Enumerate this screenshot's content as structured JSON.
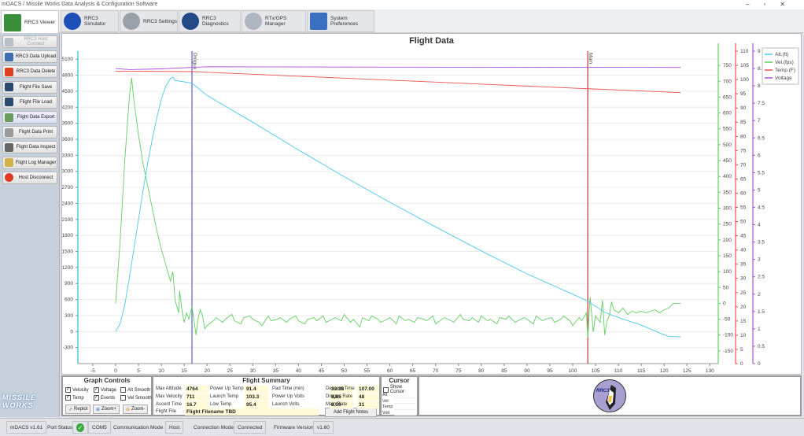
{
  "window": {
    "title": "mDACS / Missile Works Data Analysis & Configuration Software"
  },
  "tabs": [
    {
      "label": "RRC3 Viewer",
      "icon": "chart-icon",
      "color": "#3a8f3a"
    },
    {
      "label": "RRC3 Simulator",
      "icon": "rocket-icon",
      "color": "#1c4fb8"
    },
    {
      "label": "RRC3 Settings",
      "icon": "gear-icon",
      "color": "#9aa0a8"
    },
    {
      "label": "RRC3 Diagnostics",
      "icon": "waveform-icon",
      "color": "#234a86"
    },
    {
      "label": "RTx/GPS Manager",
      "icon": "compass-icon",
      "color": "#b0b6c0"
    },
    {
      "label": "System Preferences",
      "icon": "checklist-icon",
      "color": "#3b6fc0"
    }
  ],
  "sidebar": [
    {
      "label": "RRC3 Host Connect",
      "icon": "connect-icon",
      "color": "#b9bfc6",
      "disabled": true
    },
    {
      "label": "RRC3 Data Upload",
      "icon": "upload-icon",
      "color": "#3d6fb0"
    },
    {
      "label": "RRC3 Data Delete",
      "icon": "delete-x-icon",
      "color": "#e04020"
    },
    {
      "label": "Flight File Save",
      "icon": "save-icon",
      "color": "#2a4a70"
    },
    {
      "label": "Flight File Load",
      "icon": "load-icon",
      "color": "#2a4a70"
    },
    {
      "label": "Flight Data Export",
      "icon": "export-icon",
      "color": "#6c9c5a",
      "highlight": true
    },
    {
      "label": "Flight Data Print",
      "icon": "print-icon",
      "color": "#9a9a9a"
    },
    {
      "label": "Flight Data Inspect",
      "icon": "binoculars-icon",
      "color": "#666"
    },
    {
      "label": "Flight Log Manager",
      "icon": "log-icon",
      "color": "#d4b04a"
    },
    {
      "label": "Host Disconnect",
      "icon": "stop-icon",
      "color": "#e03a20"
    }
  ],
  "logo_text": "MISSILE WORKS",
  "chart_data": {
    "type": "line",
    "title": "Flight Data",
    "xlim": [
      -8,
      132
    ],
    "xticks": [
      -5,
      0,
      5,
      10,
      15,
      20,
      25,
      30,
      35,
      40,
      45,
      50,
      55,
      60,
      65,
      70,
      75,
      80,
      85,
      90,
      95,
      100,
      105,
      110,
      115,
      120,
      125,
      130
    ],
    "axes": {
      "altitude": {
        "ylim": [
          -600,
          5250
        ],
        "ticks": [
          -300,
          0,
          300,
          600,
          900,
          1200,
          1500,
          1800,
          2100,
          2400,
          2700,
          3000,
          3300,
          3600,
          3900,
          4200,
          4500,
          4800,
          5100
        ],
        "color": "#4fc8f0"
      },
      "velocity": {
        "ylim": [
          -190,
          795
        ],
        "ticks": [
          -150,
          -100,
          -50,
          0,
          50,
          100,
          150,
          200,
          250,
          300,
          350,
          400,
          450,
          500,
          550,
          600,
          650,
          700,
          750
        ],
        "color": "#62d062"
      },
      "temperature": {
        "ylim": [
          0,
          110
        ],
        "ticks": [
          0,
          5,
          10,
          15,
          20,
          25,
          30,
          35,
          40,
          45,
          50,
          55,
          60,
          65,
          70,
          75,
          80,
          85,
          90,
          95,
          100,
          105,
          110
        ],
        "color": "#f05050"
      },
      "voltage": {
        "ylim": [
          0,
          9
        ],
        "ticks": [
          0,
          0.5,
          1,
          1.5,
          2,
          2.5,
          3,
          3.5,
          4,
          4.5,
          5,
          5.5,
          6,
          6.5,
          7,
          7.5,
          8,
          8.5,
          9
        ],
        "color": "#b050e0"
      }
    },
    "legend": {
      "position": "top-right",
      "entries": [
        {
          "name": "Alt.(ft)",
          "color": "#4fc8f0"
        },
        {
          "name": "Vel.(fps)",
          "color": "#62d062"
        },
        {
          "name": "Temp.(F)",
          "color": "#f05050"
        },
        {
          "name": "Voltage",
          "color": "#b050e0"
        }
      ]
    },
    "events": [
      {
        "name": "Drogue",
        "t": 16.7,
        "color": "#6a6ad8"
      },
      {
        "name": "Main",
        "t": 103.3,
        "color": "#c84040"
      }
    ],
    "series": {
      "altitude": [
        [
          0,
          0
        ],
        [
          1,
          150
        ],
        [
          2,
          500
        ],
        [
          3,
          1000
        ],
        [
          4,
          1550
        ],
        [
          5,
          2100
        ],
        [
          6,
          2650
        ],
        [
          7,
          3150
        ],
        [
          8,
          3600
        ],
        [
          9,
          4000
        ],
        [
          10,
          4350
        ],
        [
          11,
          4600
        ],
        [
          12,
          4740
        ],
        [
          12.6,
          4764
        ],
        [
          13,
          4700
        ],
        [
          14,
          4690
        ],
        [
          16.7,
          4650
        ],
        [
          20,
          4420
        ],
        [
          30,
          3920
        ],
        [
          40,
          3400
        ],
        [
          50,
          2900
        ],
        [
          60,
          2420
        ],
        [
          70,
          1960
        ],
        [
          80,
          1510
        ],
        [
          90,
          1080
        ],
        [
          100,
          700
        ],
        [
          103.3,
          570
        ],
        [
          107,
          360
        ],
        [
          110,
          260
        ],
        [
          115,
          120
        ],
        [
          120,
          -60
        ],
        [
          121,
          -90
        ],
        [
          123.6,
          -100
        ]
      ],
      "velocity": [
        [
          0,
          0
        ],
        [
          1,
          200
        ],
        [
          2,
          450
        ],
        [
          3,
          650
        ],
        [
          3.5,
          711
        ],
        [
          4,
          640
        ],
        [
          5,
          530
        ],
        [
          6,
          440
        ],
        [
          7,
          370
        ],
        [
          8,
          300
        ],
        [
          9,
          230
        ],
        [
          10,
          170
        ],
        [
          11,
          120
        ],
        [
          12,
          70
        ],
        [
          12.5,
          100
        ],
        [
          12.8,
          50
        ],
        [
          13,
          10
        ],
        [
          13.8,
          -30
        ],
        [
          14,
          40
        ],
        [
          14.5,
          -20
        ],
        [
          15,
          -60
        ],
        [
          15.5,
          -30
        ],
        [
          16,
          -50
        ],
        [
          16.7,
          -10
        ],
        [
          17.3,
          -70
        ],
        [
          17.6,
          -100
        ],
        [
          18,
          -50
        ],
        [
          18.5,
          -20
        ],
        [
          19,
          -40
        ],
        [
          19.5,
          -80
        ]
      ],
      "velocity_noise": {
        "t_start": 20,
        "t_step": 1,
        "values": [
          -70,
          -55,
          -45,
          -60,
          -50,
          -35,
          -55,
          -65,
          -45,
          -40,
          -50,
          -60,
          -70,
          -40,
          -55,
          -50,
          -45,
          -60,
          -50,
          -40,
          -55,
          -65,
          -50,
          -45,
          -55,
          -40,
          -60,
          -50,
          -45,
          -55,
          -35,
          -60,
          -50,
          -75,
          -45,
          -55,
          -40,
          -50,
          -60,
          -50,
          -45,
          -65,
          -40,
          -55,
          -50,
          -60,
          -45,
          -50,
          -55,
          -40,
          -65,
          -50,
          -45,
          -55,
          -60,
          -35,
          -50,
          -55,
          -45,
          -60,
          -40,
          -55,
          -50,
          -65,
          -45,
          -50,
          -40,
          -60,
          -55,
          -45,
          -50,
          -65,
          -40,
          -55,
          -50,
          -45,
          -60,
          -50,
          -40,
          -55,
          -70,
          -45,
          -55
        ]
      },
      "velocity_tail": [
        [
          103,
          -30
        ],
        [
          103.3,
          -110
        ],
        [
          103.8,
          20
        ],
        [
          104.5,
          -90
        ],
        [
          105,
          -40
        ],
        [
          106,
          -60
        ],
        [
          106.5,
          10
        ],
        [
          107,
          -100
        ],
        [
          107.5,
          -55
        ],
        [
          108,
          -40
        ],
        [
          108.5,
          5
        ],
        [
          109,
          -20
        ],
        [
          110,
          -30
        ],
        [
          111,
          -15
        ],
        [
          112,
          -35
        ],
        [
          113,
          -25
        ],
        [
          114,
          -30
        ],
        [
          115,
          -25
        ],
        [
          116,
          -30
        ],
        [
          117,
          -25
        ],
        [
          118,
          -20
        ],
        [
          119,
          -30
        ],
        [
          120,
          -20
        ],
        [
          121,
          -15
        ],
        [
          122,
          0
        ],
        [
          123.6,
          0
        ]
      ],
      "temperature": [
        [
          0,
          103
        ],
        [
          16.7,
          102.8
        ],
        [
          50,
          100.5
        ],
        [
          100,
          97
        ],
        [
          123.6,
          95.4
        ]
      ],
      "voltage": [
        [
          0,
          8.5
        ],
        [
          3,
          8.47
        ],
        [
          10,
          8.49
        ],
        [
          20,
          8.55
        ],
        [
          60,
          8.54
        ],
        [
          123.6,
          8.53
        ]
      ]
    }
  },
  "graph_controls": {
    "title": "Graph Controls",
    "checks": [
      {
        "label": "Velocity",
        "checked": true
      },
      {
        "label": "Voltage",
        "checked": true
      },
      {
        "label": "Alt Smooth",
        "checked": false
      },
      {
        "label": "Temp",
        "checked": true
      },
      {
        "label": "Events",
        "checked": true
      },
      {
        "label": "Vel Smooth",
        "checked": false
      }
    ],
    "replot": "Replot",
    "zoom_in": "Zoom+",
    "zoom_out": "Zoom-"
  },
  "summary": {
    "title": "Flight Summary",
    "fields": [
      {
        "label": "Max Altitude",
        "value": "4764"
      },
      {
        "label": "Max Velocity",
        "value": "711"
      },
      {
        "label": "Ascent Time",
        "value": "16.7"
      },
      {
        "label": "Power Up Temp",
        "value": "91.4"
      },
      {
        "label": "Launch Temp",
        "value": "103.3"
      },
      {
        "label": "Low Temp",
        "value": "95.4"
      },
      {
        "label": "Pad Time (min)",
        "value": "33.38"
      },
      {
        "label": "Power Up Volts",
        "value": "8.85"
      },
      {
        "label": "Launch Volts",
        "value": "8.50"
      },
      {
        "label": "Descent Time",
        "value": "107.00"
      },
      {
        "label": "Drogue Rate",
        "value": "48"
      },
      {
        "label": "Main Rate",
        "value": "31"
      }
    ],
    "flight_file_label": "Flight File",
    "flight_file": "Flight Filename TBD",
    "add_notes": "Add Flight Notes"
  },
  "cursor": {
    "title": "Cursor",
    "show_label": "Show Cursor",
    "show": false,
    "rows": [
      "Alt",
      "Vel",
      "Temp",
      "Volt"
    ]
  },
  "rrc3_badge": "RRC3",
  "status": {
    "version": "mDACS v1.61",
    "port_label": "Port Status",
    "port": "COM5",
    "comm_label": "Communication Mode",
    "comm": "Host",
    "conn_label": "Connection Mode",
    "conn": "Connected",
    "fw_label": "Firmware Version",
    "fw": "v1.60"
  }
}
